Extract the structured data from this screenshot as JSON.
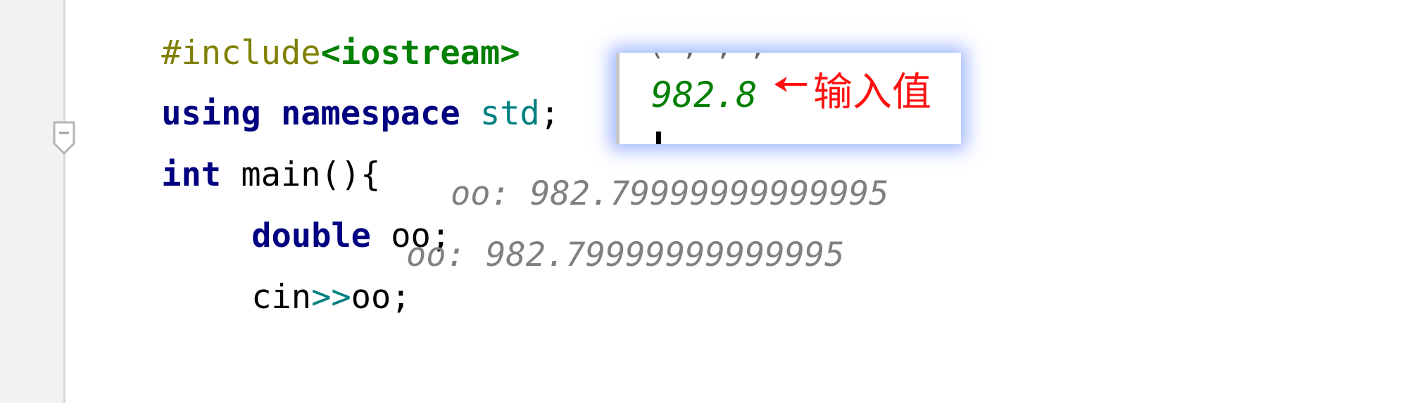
{
  "code": {
    "line1": {
      "directive": "#include",
      "header": "<iostream>"
    },
    "line2": {
      "kw_using": "using",
      "kw_namespace": "namespace",
      "ns": "std",
      "semi": ";"
    },
    "line3": {
      "kw_int": "int",
      "rest": " main(){"
    },
    "line4": {
      "kw_double": "double",
      "rest": " oo;"
    },
    "line5": {
      "cin": "cin",
      "op": ">>",
      "rest": "oo;"
    }
  },
  "inline_hints": {
    "line4": "oo: 982.79999999999995",
    "line5": "oo: 982.79999999999995"
  },
  "console_popup": {
    "top_partial": "( , , ,",
    "input_value": "982.8",
    "annotation": "输入值",
    "annotation_color": "#ff1010",
    "value_color": "#008000"
  },
  "colors": {
    "keyword": "#000080",
    "preprocessor": "#808000",
    "header": "#008000",
    "namespace": "#008080",
    "hint": "#808080",
    "popup_glow": "#5078ff"
  },
  "icons": {
    "fold": "fold-minus-icon",
    "arrow": "left-arrow-icon",
    "caret": "text-caret"
  }
}
